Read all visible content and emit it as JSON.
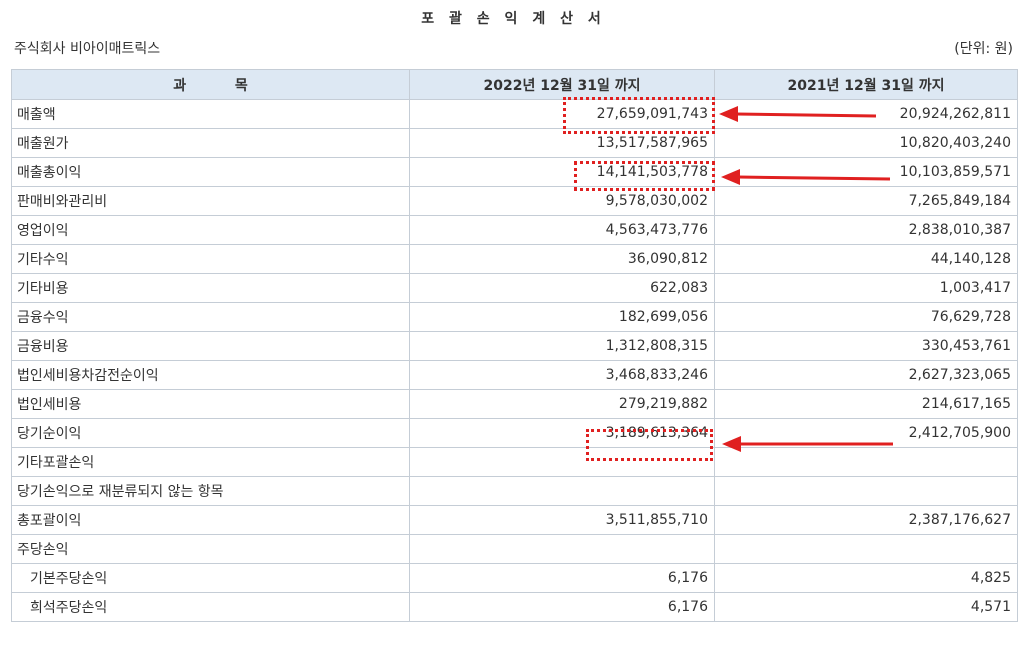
{
  "title": "포 괄 손 익 계 산 서",
  "company": "주식회사 비아이매트릭스",
  "unit": "(단위: 원)",
  "table": {
    "headers": [
      "과          목",
      "2022년 12월 31일 까지",
      "2021년 12월 31일 까지"
    ],
    "rows": [
      {
        "label": "매출액",
        "cur": "27,659,091,743",
        "prev": "20,924,262,811"
      },
      {
        "label": "매출원가",
        "cur": "13,517,587,965",
        "prev": "10,820,403,240"
      },
      {
        "label": "매출총이익",
        "cur": "14,141,503,778",
        "prev": "10,103,859,571"
      },
      {
        "label": "판매비와관리비",
        "cur": "9,578,030,002",
        "prev": "7,265,849,184"
      },
      {
        "label": "영업이익",
        "cur": "4,563,473,776",
        "prev": "2,838,010,387"
      },
      {
        "label": "기타수익",
        "cur": "36,090,812",
        "prev": "44,140,128"
      },
      {
        "label": "기타비용",
        "cur": "622,083",
        "prev": "1,003,417"
      },
      {
        "label": "금융수익",
        "cur": "182,699,056",
        "prev": "76,629,728"
      },
      {
        "label": "금융비용",
        "cur": "1,312,808,315",
        "prev": "330,453,761"
      },
      {
        "label": "법인세비용차감전순이익",
        "cur": "3,468,833,246",
        "prev": "2,627,323,065"
      },
      {
        "label": "법인세비용",
        "cur": "279,219,882",
        "prev": "214,617,165"
      },
      {
        "label": "당기순이익",
        "cur": "3,189,613,364",
        "prev": "2,412,705,900"
      },
      {
        "label": "기타포괄손익",
        "cur": "",
        "prev": ""
      },
      {
        "label": "당기손익으로 재분류되지 않는 항목",
        "cur": "",
        "prev": ""
      },
      {
        "label": "총포괄이익",
        "cur": "3,511,855,710",
        "prev": "2,387,176,627"
      },
      {
        "label": "주당손익",
        "cur": "",
        "prev": ""
      },
      {
        "label": "기본주당손익",
        "cur": "6,176",
        "prev": "4,825"
      },
      {
        "label": "희석주당손익",
        "cur": "6,176",
        "prev": "4,571"
      }
    ]
  },
  "annotations": {
    "color": "#e02020",
    "highlighted_rows": [
      "매출액",
      "매출총이익",
      "당기순이익"
    ]
  }
}
